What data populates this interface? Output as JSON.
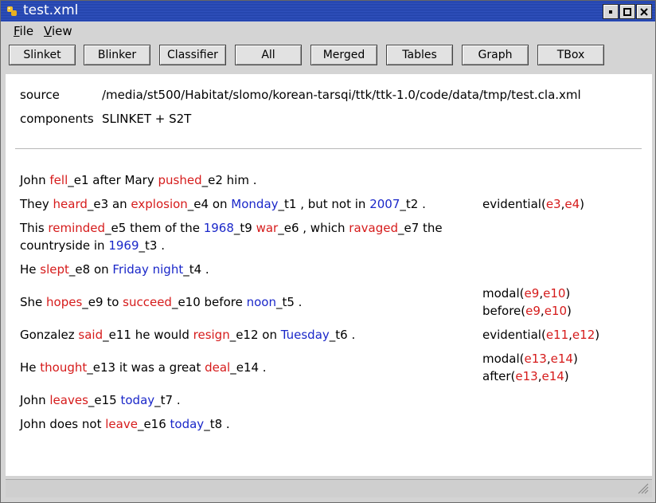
{
  "window": {
    "title": "test.xml"
  },
  "menu": {
    "file": "File",
    "view": "View"
  },
  "toolbar": {
    "buttons": [
      "Slinket",
      "Blinker",
      "Classifier",
      "All",
      "Merged",
      "Tables",
      "Graph",
      "TBox"
    ]
  },
  "meta": {
    "source_label": "source",
    "source_value": "/media/st500/Habitat/slomo/korean-tarsqi/ttk/ttk-1.0/code/data/tmp/test.cla.xml",
    "components_label": "components",
    "components_value": "SLINKET + S2T"
  },
  "colors": {
    "event": "#d61b1b",
    "timex": "#1a27c9"
  },
  "sentences": [
    {
      "s1_w1": "John ",
      "s1_e1": "fell",
      "s1_w2": "_e1 after Mary ",
      "s1_e2": "pushed",
      "s1_w3": "_e2 him ."
    }
  ],
  "s": {
    "s1": {
      "a": "John ",
      "b": "fell",
      "c": "_e1 after Mary ",
      "d": "pushed",
      "e": "_e2 him ."
    },
    "s2": {
      "a": "They ",
      "b": "heard",
      "c": "_e3 an ",
      "d": "explosion",
      "e": "_e4 on ",
      "f": "Monday",
      "g": "_t1 , but not in ",
      "h": "2007",
      "i": "_t2 ."
    },
    "s3": {
      "a": "This ",
      "b": "reminded",
      "c": "_e5 them of the ",
      "d": "1968",
      "e": "_t9 ",
      "f": "war",
      "g": "_e6 , which ",
      "h": "ravaged",
      "i": "_e7 the",
      "j": "countryside in ",
      "k": "1969",
      "l": "_t3 ."
    },
    "s4": {
      "a": "He ",
      "b": "slept",
      "c": "_e8 on ",
      "d": "Friday night",
      "e": "_t4 ."
    },
    "s5": {
      "a": "She ",
      "b": "hopes",
      "c": "_e9 to ",
      "d": "succeed",
      "e": "_e10 before ",
      "f": "noon",
      "g": "_t5 ."
    },
    "s6": {
      "a": "Gonzalez ",
      "b": "said",
      "c": "_e11 he would ",
      "d": "resign",
      "e": "_e12 on ",
      "f": "Tuesday",
      "g": "_t6 ."
    },
    "s7": {
      "a": "He ",
      "b": "thought",
      "c": "_e13 it was a great ",
      "d": "deal",
      "e": "_e14 ."
    },
    "s8": {
      "a": "John ",
      "b": "leaves",
      "c": "_e15 ",
      "d": "today",
      "e": "_t7 ."
    },
    "s9": {
      "a": "John does not ",
      "b": "leave",
      "c": "_e16 ",
      "d": "today",
      "e": "_t8 ."
    }
  },
  "links": {
    "l2": {
      "rel": "evidential",
      "a1": "e3",
      "a2": "e4"
    },
    "l5a": {
      "rel": "modal",
      "a1": "e9",
      "a2": "e10"
    },
    "l5b": {
      "rel": "before",
      "a1": "e9",
      "a2": "e10"
    },
    "l6": {
      "rel": "evidential",
      "a1": "e11",
      "a2": "e12"
    },
    "l7a": {
      "rel": "modal",
      "a1": "e13",
      "a2": "e14"
    },
    "l7b": {
      "rel": "after",
      "a1": "e13",
      "a2": "e14"
    }
  }
}
